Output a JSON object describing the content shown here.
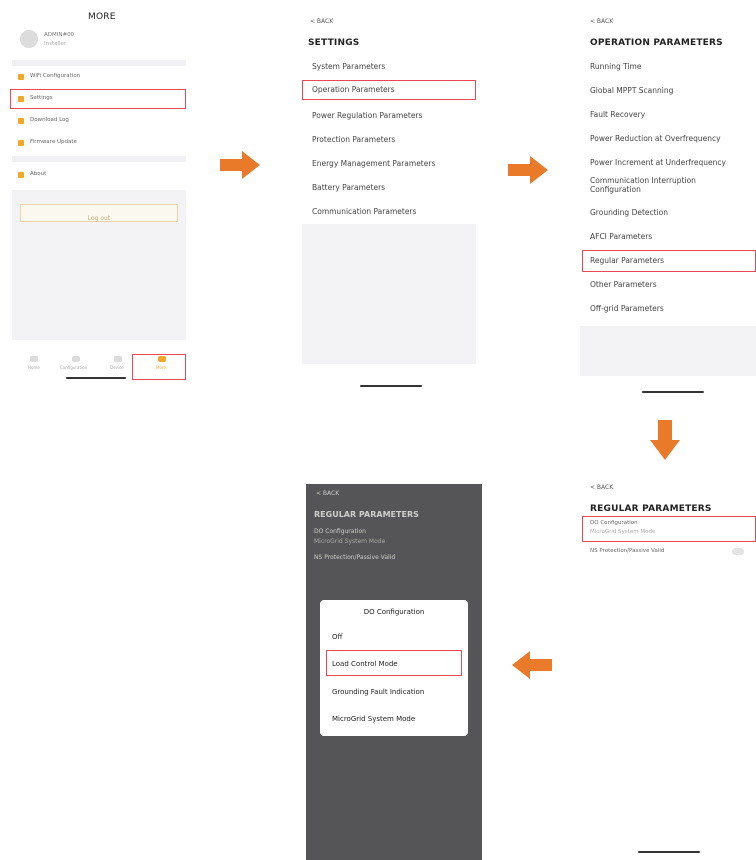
{
  "colors": {
    "highlight": "#e8485a",
    "arrow": "#e87a2a",
    "accent": "#f0a72a"
  },
  "more": {
    "title": "MORE",
    "user_name": "ADMIN#00",
    "user_sub": "Installer",
    "menu": [
      {
        "label": "WiFi Configuration",
        "icon": "wifi-icon"
      },
      {
        "label": "Settings",
        "icon": "settings-icon"
      },
      {
        "label": "Download Log",
        "icon": "download-icon"
      },
      {
        "label": "Firmware Update",
        "icon": "firmware-icon"
      },
      {
        "label": "About",
        "icon": "about-icon"
      }
    ],
    "logout_label": "Log out",
    "tabs": [
      {
        "label": "Home",
        "icon": "home-icon"
      },
      {
        "label": "Configuration",
        "icon": "config-icon"
      },
      {
        "label": "Device",
        "icon": "device-icon"
      },
      {
        "label": "More",
        "icon": "more-icon"
      }
    ]
  },
  "settings": {
    "back": "< BACK",
    "title": "SETTINGS",
    "items": [
      "System Parameters",
      "Operation Parameters",
      "Power Regulation Parameters",
      "Protection Parameters",
      "Energy Management Parameters",
      "Battery Parameters",
      "Communication Parameters"
    ]
  },
  "operation": {
    "back": "< BACK",
    "title": "OPERATION PARAMETERS",
    "items": [
      "Running Time",
      "Global MPPT Scanning",
      "Fault Recovery",
      "Power Reduction at Overfrequency",
      "Power Increment at Underfrequency",
      "Communication Interruption Configuration",
      "Grounding Detection",
      "AFCI Parameters",
      "Regular Parameters",
      "Other Parameters",
      "Off-grid Parameters"
    ]
  },
  "regular": {
    "back": "< BACK",
    "title": "REGULAR PARAMETERS",
    "do_label": "DO Configuration",
    "do_value": "MicroGrid System Mode",
    "ns_label": "NS Protection/Passive Valid"
  },
  "modal_screen": {
    "back": "< BACK",
    "title": "REGULAR PARAMETERS",
    "bg_line1": "DO Configuration",
    "bg_line2": "MicroGrid System Mode",
    "bg_line3": "NS Protection/Passive Valid",
    "modal_title": "DO Configuration",
    "options": [
      "Off",
      "Load Control Mode",
      "Grounding Fault Indication",
      "MicroGrid System Mode"
    ]
  }
}
